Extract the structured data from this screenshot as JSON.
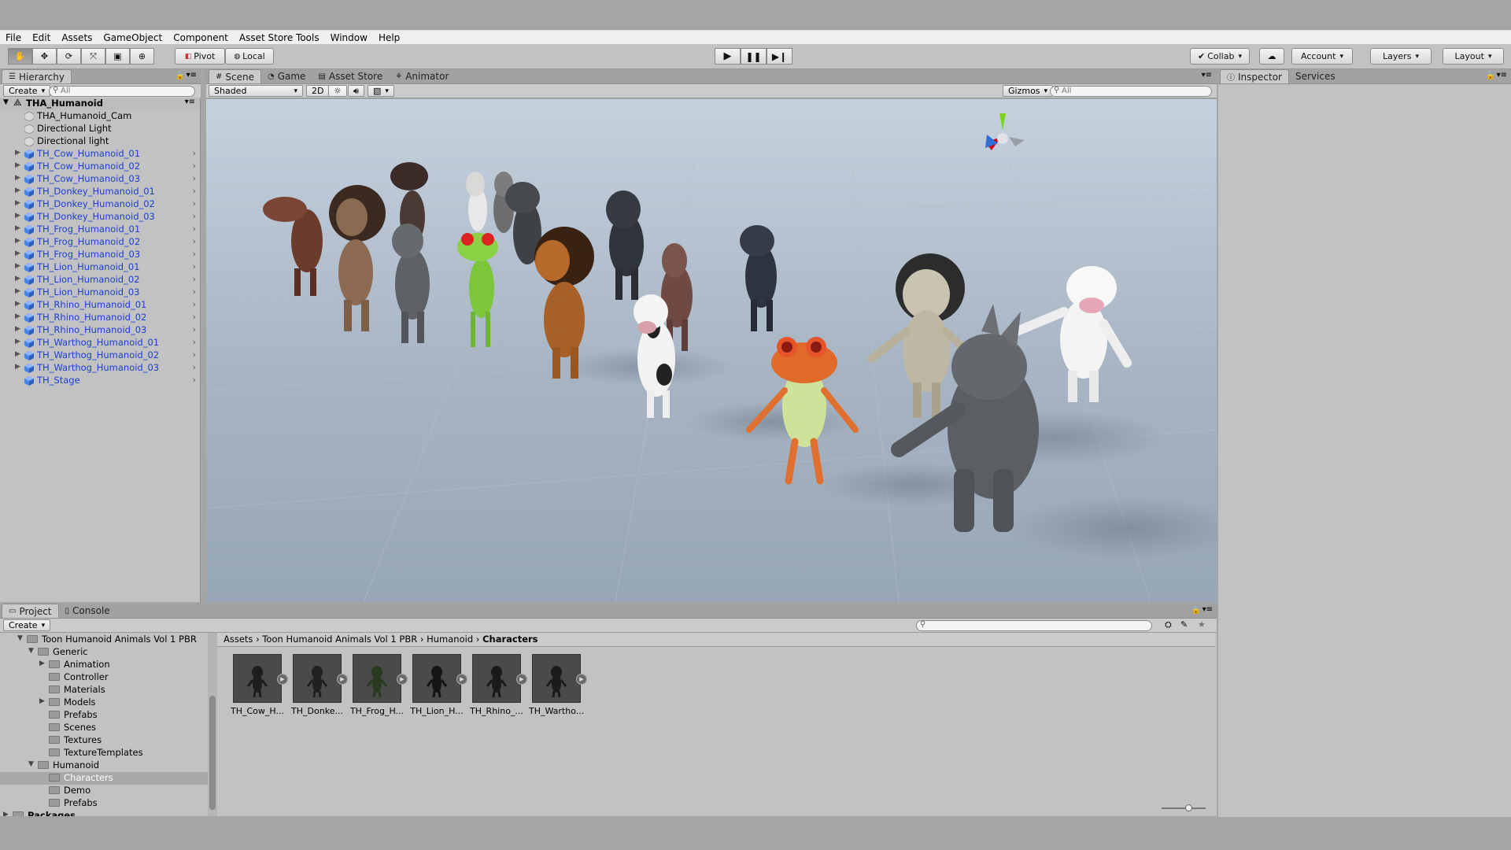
{
  "menu": [
    "File",
    "Edit",
    "Assets",
    "GameObject",
    "Component",
    "Asset Store Tools",
    "Window",
    "Help"
  ],
  "toolbar": {
    "pivot": "Pivot",
    "local": "Local",
    "collab": "Collab",
    "account": "Account",
    "layers": "Layers",
    "layout": "Layout"
  },
  "hierarchy": {
    "tab": "Hierarchy",
    "create": "Create",
    "search_placeholder": "All",
    "scene": "THA_Humanoid",
    "items": [
      {
        "label": "THA_Humanoid_Cam",
        "prefab": false
      },
      {
        "label": "Directional Light",
        "prefab": false
      },
      {
        "label": "Directional light",
        "prefab": false
      },
      {
        "label": "TH_Cow_Humanoid_01",
        "prefab": true
      },
      {
        "label": "TH_Cow_Humanoid_02",
        "prefab": true
      },
      {
        "label": "TH_Cow_Humanoid_03",
        "prefab": true
      },
      {
        "label": "TH_Donkey_Humanoid_01",
        "prefab": true
      },
      {
        "label": "TH_Donkey_Humanoid_02",
        "prefab": true
      },
      {
        "label": "TH_Donkey_Humanoid_03",
        "prefab": true
      },
      {
        "label": "TH_Frog_Humanoid_01",
        "prefab": true
      },
      {
        "label": "TH_Frog_Humanoid_02",
        "prefab": true
      },
      {
        "label": "TH_Frog_Humanoid_03",
        "prefab": true
      },
      {
        "label": "TH_Lion_Humanoid_01",
        "prefab": true
      },
      {
        "label": "TH_Lion_Humanoid_02",
        "prefab": true
      },
      {
        "label": "TH_Lion_Humanoid_03",
        "prefab": true
      },
      {
        "label": "TH_Rhino_Humanoid_01",
        "prefab": true
      },
      {
        "label": "TH_Rhino_Humanoid_02",
        "prefab": true
      },
      {
        "label": "TH_Rhino_Humanoid_03",
        "prefab": true
      },
      {
        "label": "TH_Warthog_Humanoid_01",
        "prefab": true
      },
      {
        "label": "TH_Warthog_Humanoid_02",
        "prefab": true
      },
      {
        "label": "TH_Warthog_Humanoid_03",
        "prefab": true
      },
      {
        "label": "TH_Stage",
        "prefab": true
      }
    ]
  },
  "scene_tabs": [
    "Scene",
    "Game",
    "Asset Store",
    "Animator"
  ],
  "scene_bar": {
    "shading": "Shaded",
    "mode_2d": "2D",
    "gizmos": "Gizmos",
    "search_placeholder": "All"
  },
  "inspector_tabs": [
    "Inspector",
    "Services"
  ],
  "project": {
    "tabs": [
      "Project",
      "Console"
    ],
    "create": "Create",
    "tree": [
      {
        "label": "Toon Humanoid Animals  Vol 1 PBR",
        "depth": 1,
        "expanded": true,
        "bold": false,
        "selected": false
      },
      {
        "label": "Generic",
        "depth": 2,
        "expanded": true,
        "bold": false,
        "selected": false
      },
      {
        "label": "Animation",
        "depth": 3,
        "expanded": false,
        "bold": false,
        "selected": false
      },
      {
        "label": "Controller",
        "depth": 3,
        "expanded": null,
        "bold": false,
        "selected": false
      },
      {
        "label": "Materials",
        "depth": 3,
        "expanded": null,
        "bold": false,
        "selected": false
      },
      {
        "label": "Models",
        "depth": 3,
        "expanded": false,
        "bold": false,
        "selected": false
      },
      {
        "label": "Prefabs",
        "depth": 3,
        "expanded": null,
        "bold": false,
        "selected": false
      },
      {
        "label": "Scenes",
        "depth": 3,
        "expanded": null,
        "bold": false,
        "selected": false
      },
      {
        "label": "Textures",
        "depth": 3,
        "expanded": null,
        "bold": false,
        "selected": false
      },
      {
        "label": "TextureTemplates",
        "depth": 3,
        "expanded": null,
        "bold": false,
        "selected": false
      },
      {
        "label": "Humanoid",
        "depth": 2,
        "expanded": true,
        "bold": false,
        "selected": false
      },
      {
        "label": "Characters",
        "depth": 3,
        "expanded": null,
        "bold": false,
        "selected": true
      },
      {
        "label": "Demo",
        "depth": 3,
        "expanded": null,
        "bold": false,
        "selected": false
      },
      {
        "label": "Prefabs",
        "depth": 3,
        "expanded": null,
        "bold": false,
        "selected": false
      },
      {
        "label": "Packages",
        "depth": 0,
        "expanded": false,
        "bold": true,
        "selected": false
      }
    ],
    "breadcrumb": [
      "Assets",
      "Toon Humanoid Animals  Vol 1 PBR",
      "Humanoid",
      "Characters"
    ],
    "assets": [
      "TH_Cow_H...",
      "TH_Donke...",
      "TH_Frog_H...",
      "TH_Lion_H...",
      "TH_Rhino_...",
      "TH_Wartho..."
    ]
  },
  "colors": {
    "prefab_blue": "#1b3ed8",
    "selection": "#8fa8d0",
    "editor_bg": "#c2c2c2"
  }
}
